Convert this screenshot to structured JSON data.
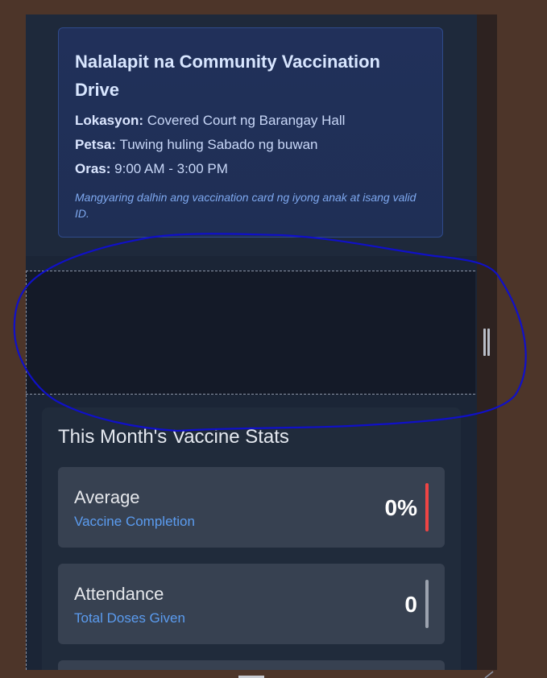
{
  "notice": {
    "title": "Nalalapit na Community Vaccination Drive",
    "location_label": "Lokasyon:",
    "location_value": " Covered Court ng Barangay Hall",
    "date_label": "Petsa:",
    "date_value": " Tuwing huling Sabado ng buwan",
    "time_label": "Oras:",
    "time_value": " 9:00 AM - 3:00 PM",
    "note": "Mangyaring dalhin ang vaccination card ng iyong anak at isang valid ID."
  },
  "stats": {
    "title": "This Month's Vaccine Stats",
    "cards": [
      {
        "label": "Average",
        "sub": "Vaccine Completion",
        "value": "0%",
        "bar_color": "#ef4444"
      },
      {
        "label": "Attendance",
        "sub": "Total Doses Given",
        "value": "0",
        "bar_color": "#9ca3af"
      }
    ]
  },
  "colors": {
    "page_bg": "#4d3529",
    "panel_bg": "#1b2536",
    "notice_border": "#2f4a8a",
    "annotation_stroke": "#1010c8",
    "accent_link": "#5b9cf0"
  },
  "icons": [
    "resize-handle-icon"
  ]
}
